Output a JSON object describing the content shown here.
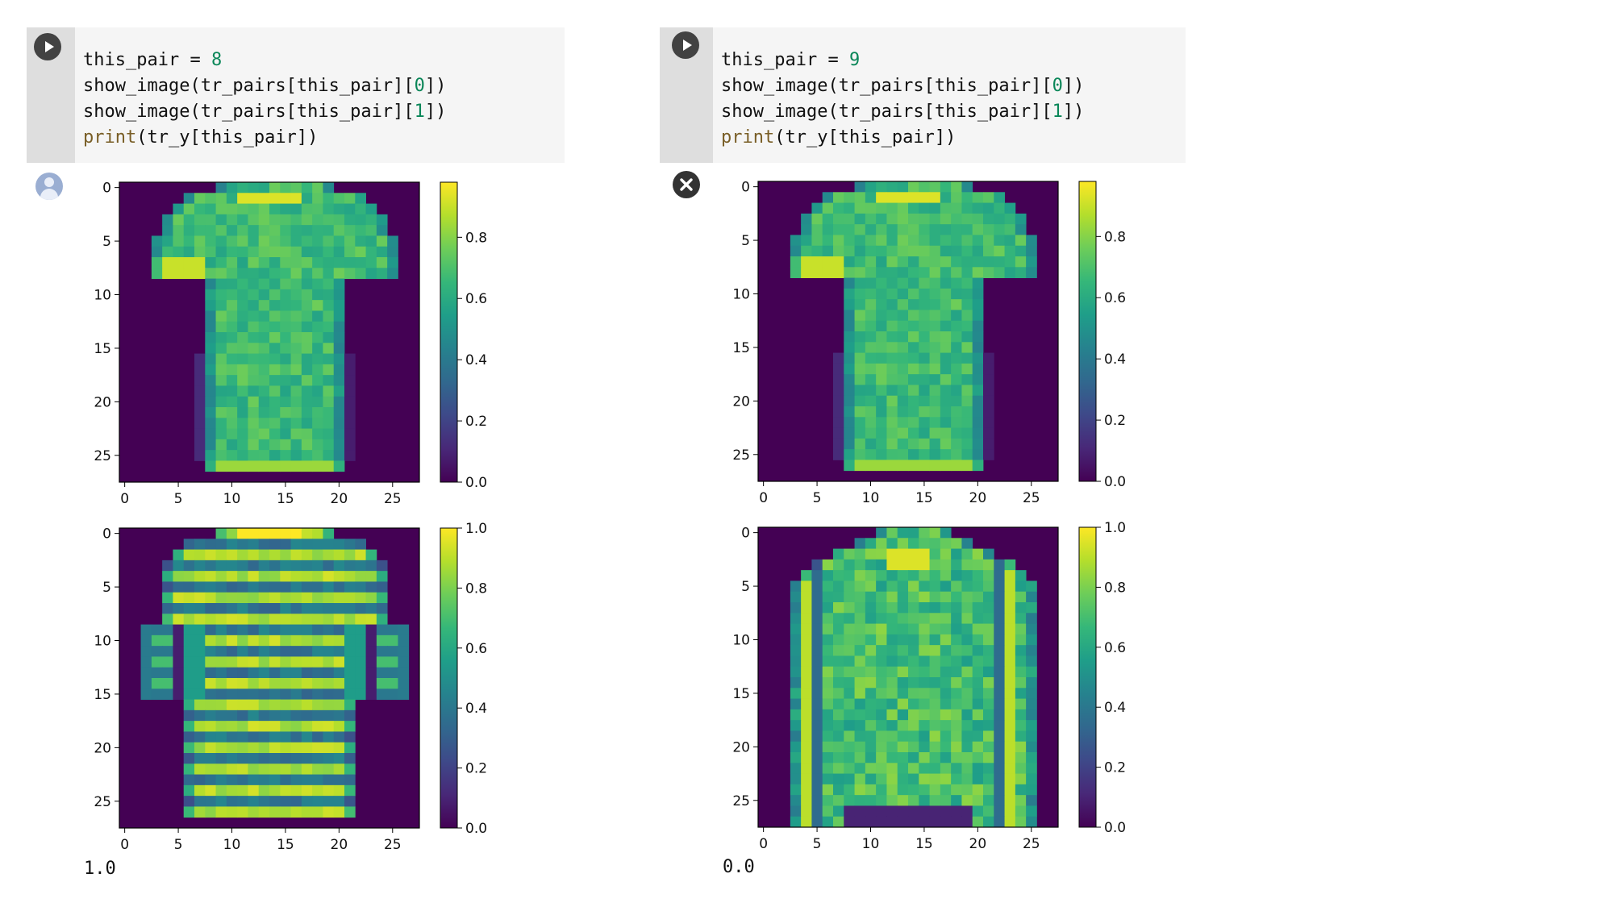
{
  "cells": [
    {
      "code_lines": [
        [
          {
            "t": "this_pair = "
          },
          {
            "t": "8",
            "c": "num"
          }
        ],
        [
          {
            "t": "show_image(tr_pairs[this_pair]["
          },
          {
            "t": "0",
            "c": "num"
          },
          {
            "t": "])"
          }
        ],
        [
          {
            "t": "show_image(tr_pairs[this_pair]["
          },
          {
            "t": "1",
            "c": "num"
          },
          {
            "t": "])"
          }
        ],
        [
          {
            "t": "print",
            "c": "fn"
          },
          {
            "t": "(tr_y[this_pair])"
          }
        ]
      ],
      "output_status_icon": "user-avatar-icon",
      "printed_output": "1.0",
      "images": [
        {
          "garment": "tshirt-plain",
          "colorbar_ticks": [
            "0.0",
            "0.2",
            "0.4",
            "0.6",
            "0.8"
          ],
          "colorbar_max": 0.98
        },
        {
          "garment": "tshirt-striped",
          "colorbar_ticks": [
            "0.0",
            "0.2",
            "0.4",
            "0.6",
            "0.8",
            "1.0"
          ],
          "colorbar_max": 1.0
        }
      ]
    },
    {
      "code_lines": [
        [
          {
            "t": "this_pair = "
          },
          {
            "t": "9",
            "c": "num"
          }
        ],
        [
          {
            "t": "show_image(tr_pairs[this_pair]["
          },
          {
            "t": "0",
            "c": "num"
          },
          {
            "t": "])"
          }
        ],
        [
          {
            "t": "show_image(tr_pairs[this_pair]["
          },
          {
            "t": "1",
            "c": "num"
          },
          {
            "t": "])"
          }
        ],
        [
          {
            "t": "print",
            "c": "fn"
          },
          {
            "t": "(tr_y[this_pair])"
          }
        ]
      ],
      "output_status_icon": "error-x-icon",
      "printed_output": "0.0",
      "images": [
        {
          "garment": "tshirt-plain",
          "colorbar_ticks": [
            "0.0",
            "0.2",
            "0.4",
            "0.6",
            "0.8"
          ],
          "colorbar_max": 0.98
        },
        {
          "garment": "pullover",
          "colorbar_ticks": [
            "0.0",
            "0.2",
            "0.4",
            "0.6",
            "0.8",
            "1.0"
          ],
          "colorbar_max": 1.0
        }
      ]
    }
  ],
  "image_axes": {
    "xticks": [
      "0",
      "5",
      "10",
      "15",
      "20",
      "25"
    ],
    "yticks": [
      "0",
      "5",
      "10",
      "15",
      "20",
      "25"
    ],
    "pixels": 28
  },
  "colormap": "viridis",
  "colors": {
    "code_number": "#098658",
    "code_function": "#795e26",
    "plot_background": "#440154"
  }
}
